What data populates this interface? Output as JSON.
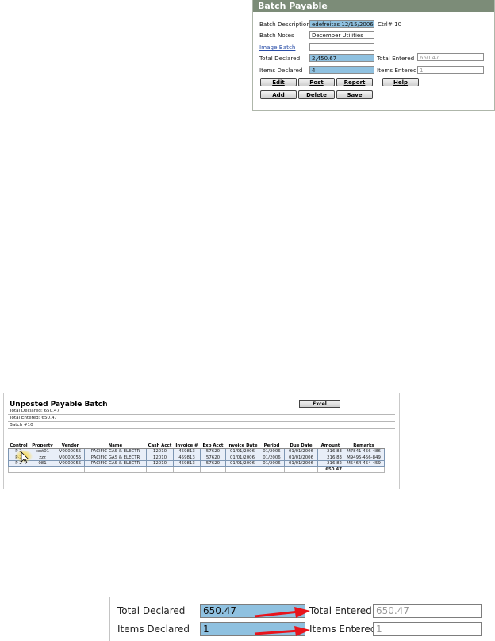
{
  "batch_payable": {
    "title": "Batch Payable",
    "batch_description_label": "Batch Description",
    "batch_description_value": "edefreitas 12/15/2006",
    "ctrl_label": "Ctrl# 10",
    "batch_notes_label": "Batch Notes",
    "batch_notes_value": "December Utilities",
    "image_batch_label": "Image Batch",
    "image_batch_value": "",
    "total_declared_label": "Total Declared",
    "total_declared_value": "2,450.67",
    "total_entered_label": "Total Entered",
    "total_entered_value": "650.47",
    "items_declared_label": "Items Declared",
    "items_declared_value": "4",
    "items_entered_label": "Items Entered",
    "items_entered_value": "1",
    "buttons": {
      "edit": "Edit",
      "post": "Post",
      "report": "Report",
      "help": "Help",
      "add": "Add",
      "delete": "Delete",
      "save": "Save"
    },
    "colors": {
      "header_bg": "#7c8c78",
      "field_highlight": "#8fc1e0"
    }
  },
  "report": {
    "title": "Unposted Payable Batch",
    "excel_label": "Excel",
    "total_declared_line": "Total Declared: 650.47",
    "total_entered_line": "Total Entered: 650.47",
    "batch_line": "Batch #10",
    "headers": [
      "Control",
      "Property",
      "Vendor",
      "Name",
      "Cash Acct",
      "Invoice #",
      "Exp Acct",
      "Invoice Date",
      "Period",
      "Due Date",
      "Amount",
      "Remarks"
    ],
    "rows": [
      [
        "P-2",
        "test01",
        "V0000055",
        "PACIFIC GAS & ELECTR",
        "12010",
        "459813",
        "57620",
        "01/01/2006",
        "01/2006",
        "01/01/2006",
        "216.83",
        "M7841-456-486"
      ],
      [
        "P-2",
        "zzz",
        "V0000055",
        "PACIFIC GAS & ELECTR",
        "12010",
        "459813",
        "57620",
        "01/01/2006",
        "01/2006",
        "01/01/2006",
        "216.83",
        "M9495-456-849"
      ],
      [
        "P-2",
        "081",
        "V0000055",
        "PACIFIC GAS & ELECTR",
        "12010",
        "459813",
        "57620",
        "01/01/2006",
        "01/2006",
        "01/01/2006",
        "216.82",
        "M5464-454-459"
      ]
    ],
    "total_amount": "650.47"
  },
  "zoom": {
    "total_declared_label": "Total Declared",
    "total_declared_value": "650.47",
    "total_entered_label": "Total Entered",
    "total_entered_value": "650.47",
    "items_declared_label": "Items Declared",
    "items_declared_value": "1",
    "items_entered_label": "Items Entered",
    "items_entered_value": "1",
    "arrow_color": "#e8141c"
  }
}
